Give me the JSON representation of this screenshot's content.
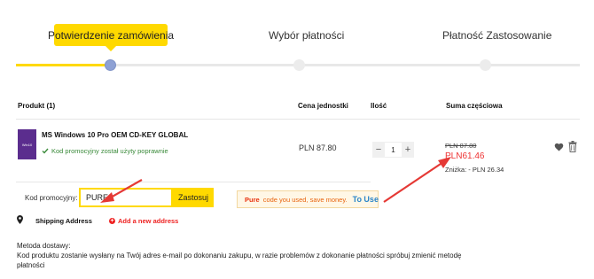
{
  "steps": [
    {
      "label": "Potwierdzenie zamówienia",
      "active": true
    },
    {
      "label": "Wybór płatności",
      "active": false
    },
    {
      "label": "Płatność Zastosowanie",
      "active": false
    }
  ],
  "table": {
    "headers": {
      "product": "Produkt (1)",
      "unit_price": "Cena jednostki",
      "quantity": "Ilość",
      "subtotal": "Suma częściowa"
    }
  },
  "item": {
    "thumb_text": "Win10",
    "name": "MS Windows 10 Pro OEM CD-KEY GLOBAL",
    "promo_applied": "Kod promocyjny został użyty poprawnie",
    "unit_price": "PLN 87.80",
    "quantity": "1",
    "qty_minus": "−",
    "qty_plus": "+",
    "old_price": "PLN 87.80",
    "new_price": "PLN61.46",
    "discount": "Zniżka: - PLN 26.34"
  },
  "promo": {
    "label": "Kod promocyjny:",
    "value": "PURE",
    "apply": "Zastosuj",
    "notice_code": "Pure",
    "notice_text": "code you used, save money.",
    "notice_link": "To Use"
  },
  "shipping": {
    "label": "Shipping Address",
    "add": "Add a new address"
  },
  "delivery": {
    "title": "Metoda dostawy:",
    "text": "Kod produktu zostanie wysłany na Twój adres e-mail po dokonaniu zakupu, w razie problemów z dokonanie płatności spróbuj zmienić metodę płatności"
  },
  "colors": {
    "accent": "#ffd900",
    "price_red": "#e33333",
    "arrow_red": "#e53935",
    "link_blue": "#2c86c9"
  }
}
